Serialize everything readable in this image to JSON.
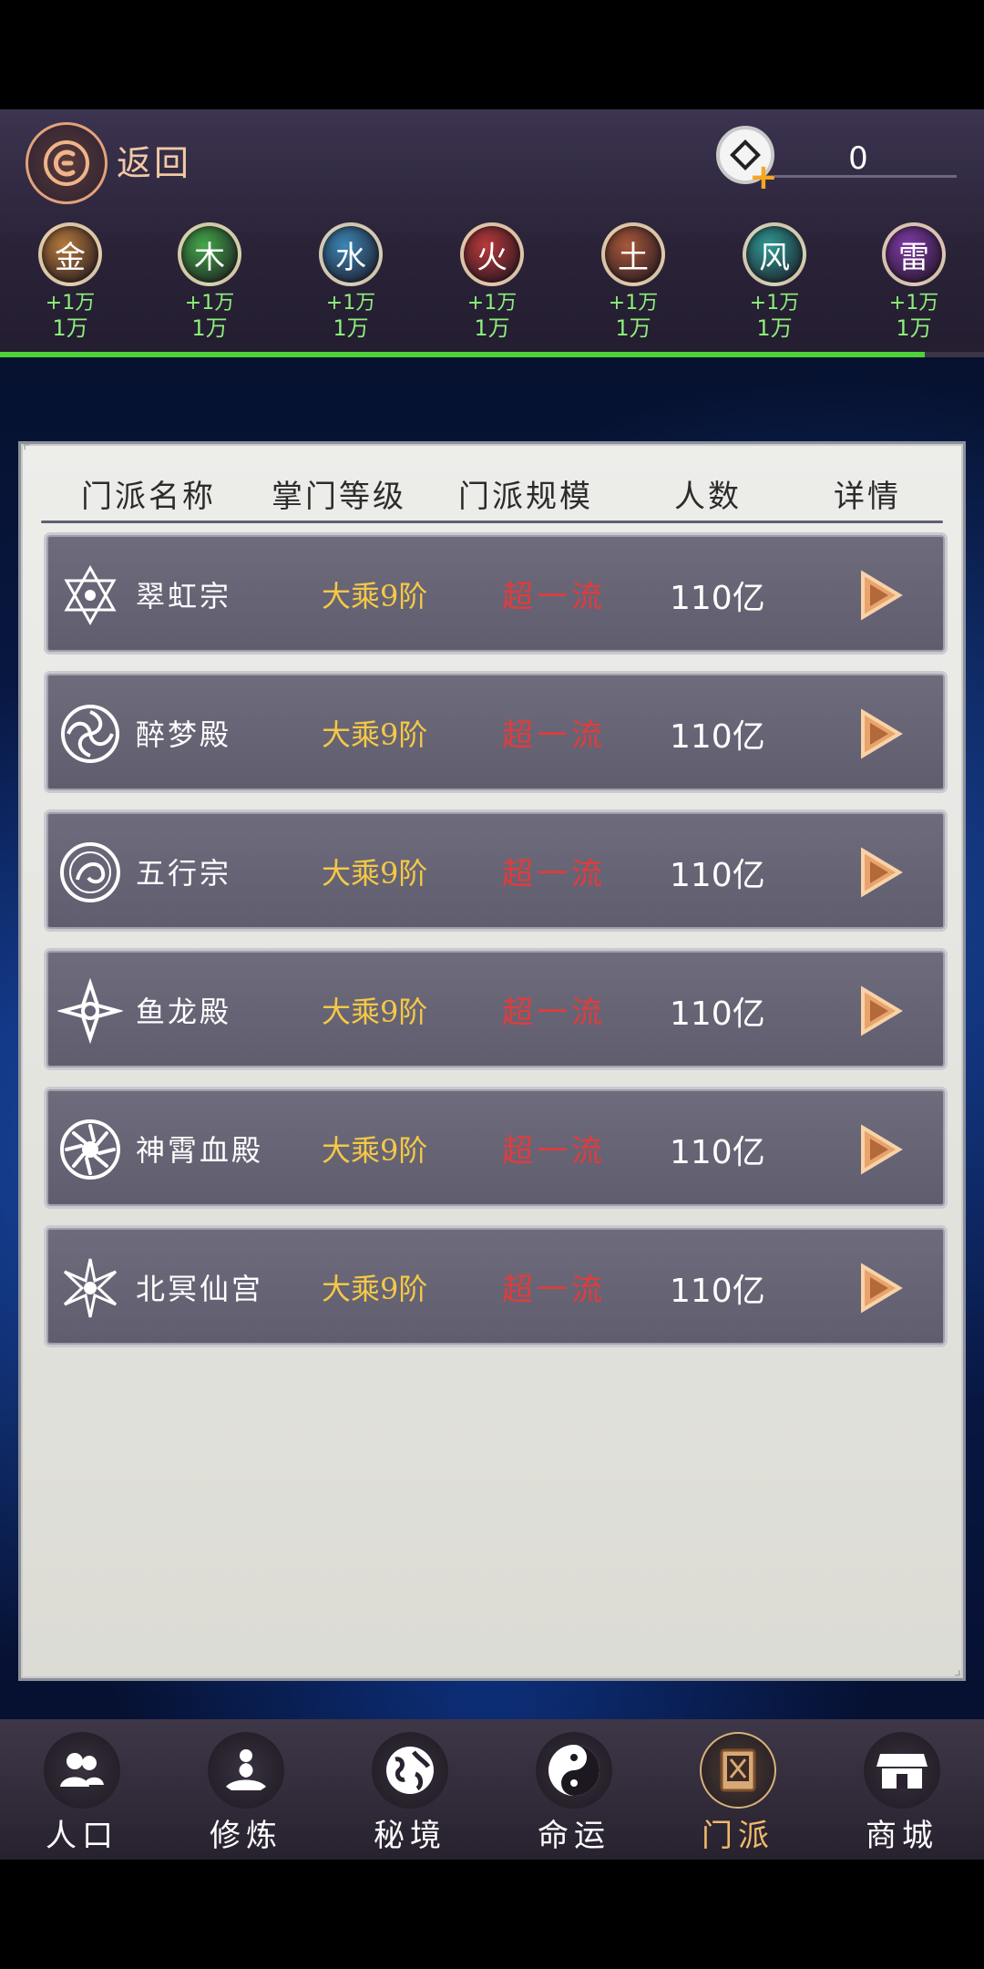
{
  "header": {
    "back_label": "返回",
    "currency": {
      "value": "0"
    }
  },
  "elements": [
    {
      "label": "金",
      "gain": "+1万",
      "amount": "1万",
      "color": "#b67a3c"
    },
    {
      "label": "木",
      "gain": "+1万",
      "amount": "1万",
      "color": "#43a84a"
    },
    {
      "label": "水",
      "gain": "+1万",
      "amount": "1万",
      "color": "#3b86b8"
    },
    {
      "label": "火",
      "gain": "+1万",
      "amount": "1万",
      "color": "#b8393a"
    },
    {
      "label": "土",
      "gain": "+1万",
      "amount": "1万",
      "color": "#a9583a"
    },
    {
      "label": "风",
      "gain": "+1万",
      "amount": "1万",
      "color": "#2f9a96"
    },
    {
      "label": "雷",
      "gain": "+1万",
      "amount": "1万",
      "color": "#7f3aa8"
    }
  ],
  "progress_fraction": 0.94,
  "table": {
    "columns": [
      "门派名称",
      "掌门等级",
      "门派规模",
      "人数",
      "详情"
    ],
    "rows": [
      {
        "name": "翠虹宗",
        "rank": "大乘9阶",
        "scale": "超一流",
        "count": "110亿",
        "emblem": "hexagram-emblem"
      },
      {
        "name": "醉梦殿",
        "rank": "大乘9阶",
        "scale": "超一流",
        "count": "110亿",
        "emblem": "vortex-emblem"
      },
      {
        "name": "五行宗",
        "rank": "大乘9阶",
        "scale": "超一流",
        "count": "110亿",
        "emblem": "phoenix-emblem"
      },
      {
        "name": "鱼龙殿",
        "rank": "大乘9阶",
        "scale": "超一流",
        "count": "110亿",
        "emblem": "shuriken-emblem"
      },
      {
        "name": "神霄血殿",
        "rank": "大乘9阶",
        "scale": "超一流",
        "count": "110亿",
        "emblem": "sun-spiral-emblem"
      },
      {
        "name": "北冥仙宫",
        "rank": "大乘9阶",
        "scale": "超一流",
        "count": "110亿",
        "emblem": "star-burst-emblem"
      }
    ]
  },
  "nav": [
    {
      "label": "人口",
      "icon": "people-icon",
      "active": false
    },
    {
      "label": "修炼",
      "icon": "meditation-icon",
      "active": false
    },
    {
      "label": "秘境",
      "icon": "globe-icon",
      "active": false
    },
    {
      "label": "命运",
      "icon": "yin-yang-icon",
      "active": false
    },
    {
      "label": "门派",
      "icon": "sect-book-icon",
      "active": true
    },
    {
      "label": "商城",
      "icon": "shop-icon",
      "active": false
    }
  ]
}
